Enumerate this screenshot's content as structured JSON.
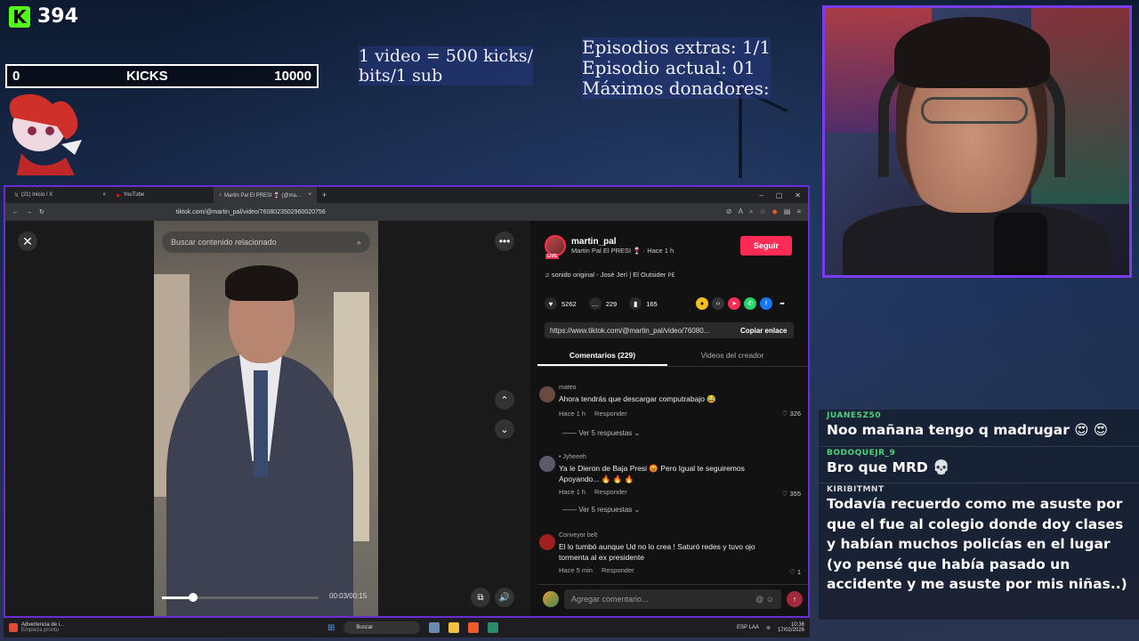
{
  "overlay": {
    "kick_count": "394",
    "kicks_min": "0",
    "kicks_label": "KICKS",
    "kicks_max": "10000",
    "promo_line1": "1 video = 500 kicks/",
    "promo_line2": "bits/1 sub",
    "info_line1": "Episodios extras: 1/1",
    "info_line2": "Episodio actual: 01",
    "info_line3": "Máximos donadores:"
  },
  "browser": {
    "tabs": [
      {
        "label": "(21) Inicio / X",
        "icon": "x-logo-icon"
      },
      {
        "label": "YouTube",
        "icon": "youtube-icon"
      },
      {
        "label": "Martin Pal El PRESI 🍷 (@ma...",
        "icon": "tiktok-icon",
        "active": true
      }
    ],
    "url": "tiktok.com/@martin_pal/video/7608023502960020756"
  },
  "video": {
    "search_placeholder": "Buscar contenido relacionado",
    "time": "00:03/00:15",
    "progress": 0.2
  },
  "author": {
    "username": "martin_pal",
    "live_badge": "LIVE",
    "display_name": "Martin Pal El PRESI 🍷",
    "posted": "· Hace 1 h",
    "follow_label": "Seguir",
    "sound": "sonido original - José Jerí | El Outsider",
    "sound_badge": "PE"
  },
  "stats": {
    "likes": "5262",
    "comments": "229",
    "saves": "165"
  },
  "share": {
    "link": "https://www.tiktok.com/@martin_pal/video/76080...",
    "copy_label": "Copiar enlace"
  },
  "panel_tabs": {
    "comments": "Comentarios (229)",
    "creator_videos": "Videos del creador"
  },
  "comments": [
    {
      "user": "mateo",
      "text": "Ahora tendrás que descargar computrabajo 😂",
      "time": "Hace 1 h",
      "reply": "Responder",
      "likes": "326",
      "replies": "Ver 5 respuestas ⌄",
      "color": "#6a4a40"
    },
    {
      "user": "• Jyheeeh",
      "text": "Ya le Dieron de Baja Presi 😡 Pero Igual te seguiremos Apoyando... 🔥 🔥 🔥",
      "time": "Hace 1 h",
      "reply": "Responder",
      "likes": "355",
      "replies": "Ver 5 respuestas ⌄",
      "color": "#5a5a6a"
    },
    {
      "user": "Conveyor belt",
      "text": "El lo tumbó aunque Ud no lo crea ! Saturó redes y tuvo ojo tormenta al ex presidente",
      "time": "Hace 5 min",
      "reply": "Responder",
      "likes": "1",
      "replies": "",
      "color": "#a02020"
    }
  ],
  "comment_input": {
    "placeholder": "Agregar comentario..."
  },
  "chat": [
    {
      "user": "JUANESZ50",
      "text": "Noo mañana tengo q madrugar 😍 😍",
      "color": "#4ed07a"
    },
    {
      "user": "BODOQUEJR_9",
      "text": "Bro que MRD 💀",
      "color": "#4ed07a"
    },
    {
      "user": "KIRIBITMNT",
      "text": "Todavía recuerdo como me asuste por que el fue al colegio donde doy clases y habían muchos policías en el lugar (yo pensé que había pasado un accidente y me asuste por mis niñas..)",
      "color": "#d8d8d8"
    }
  ],
  "taskbar": {
    "notice_title": "Advertencia de i...",
    "notice_sub": "Empieza pronto",
    "search": "Buscar",
    "lang": "ESP LAA",
    "time": "10:36",
    "date": "17/02/2026"
  },
  "colors": {
    "tiktok_red": "#fe2c55",
    "kick_green": "#53fc18",
    "frame_purple": "#7b3cf0"
  }
}
